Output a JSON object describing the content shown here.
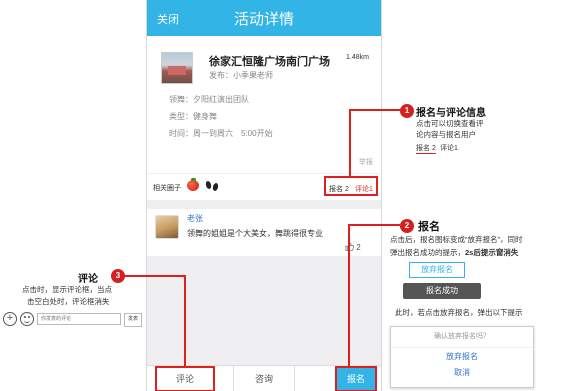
{
  "header": {
    "close_label": "关闭",
    "title": "活动详情"
  },
  "event": {
    "venue": "徐家汇恒隆广场南门广场",
    "distance": "1.48km",
    "poster": "发布：小季果老师",
    "leader": "领舞：夕阳红演出团队",
    "type": "类型：健身舞",
    "time": "时间：周一到周六　5:00开始",
    "report_label": "举报"
  },
  "circles": {
    "label": "相关圈子",
    "icons": [
      "tomato-icon",
      "footprint-icon"
    ]
  },
  "tabs": {
    "signup": "报名 2",
    "comments": "评论1"
  },
  "comment": {
    "name": "老张",
    "text": "领舞的姐姐是个大美女，舞跳得很专业",
    "likes": "2"
  },
  "bottom_bar": {
    "comment": "评论",
    "consult": "咨询",
    "signup": "报名"
  },
  "annotations": {
    "one": {
      "number": "1",
      "title": "报名与评论信息",
      "line1": "点击可以切换查看评",
      "line2": "论内容与报名用户",
      "tab_signup": "报名 2",
      "tab_comment": "评论1"
    },
    "two": {
      "number": "2",
      "title": "报名",
      "line1": "点击后，报名图标变成“放弃报名”，同时",
      "line2_a": "弹出报名成功的提示，",
      "line2_b": "2s后提示窗消失",
      "cancel_btn": "放弃报名",
      "toast": "报名成功",
      "line3": "此时，若点击放弃报名，弹出以下提示",
      "dialog_title": "确认放弃报名吗？",
      "dialog_confirm": "放弃报名",
      "dialog_cancel": "取消"
    },
    "three": {
      "number": "3",
      "title": "评论",
      "line1": "点击时，显示评论框，当点",
      "line2": "击空白处时，评论框消失",
      "input_placeholder": "你发表的评论",
      "send": "发表"
    }
  },
  "colors": {
    "accent": "#33b4e6",
    "callout": "#e02020",
    "link": "#3273c8"
  }
}
